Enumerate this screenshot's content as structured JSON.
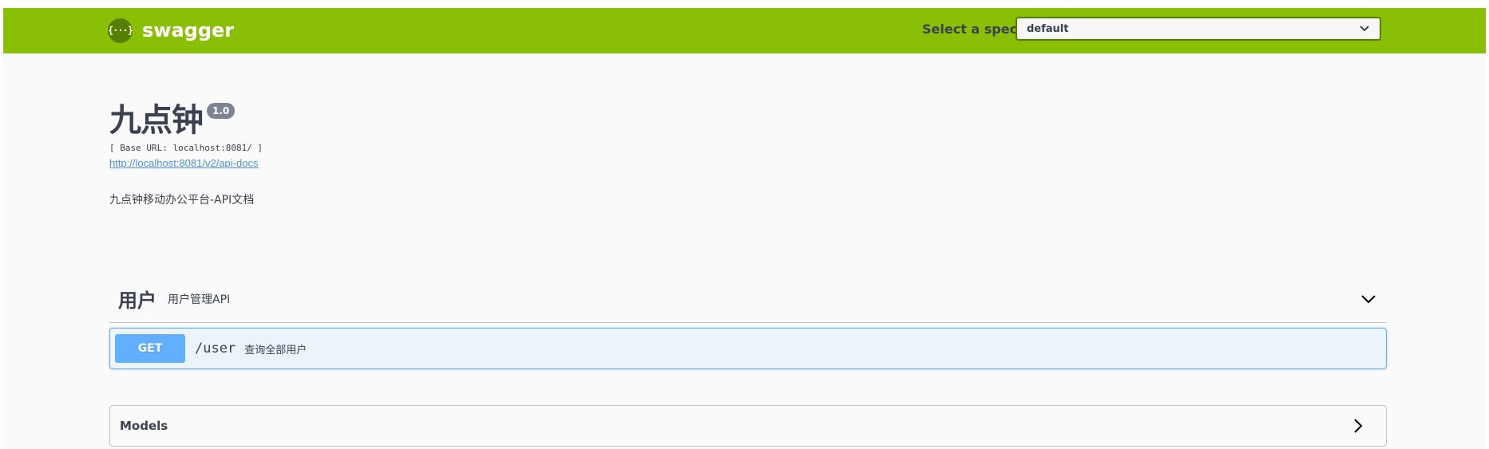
{
  "header": {
    "logo_glyph": "{···}",
    "brand_name": "swagger",
    "spec_label": "Select a spec",
    "spec_selected": "default",
    "bar_color": "#89bf04"
  },
  "info": {
    "title": "九点钟",
    "version": "1.0",
    "base_url": "[ Base URL: localhost:8081/ ]",
    "api_docs_url": "http://localhost:8081/v2/api-docs",
    "description": "九点钟移动办公平台-API文档"
  },
  "tags": [
    {
      "name": "用户",
      "description": "用户管理API",
      "expanded": true,
      "operations": [
        {
          "method": "GET",
          "path": "/user",
          "summary": "查询全部用户",
          "color": "#61affe"
        }
      ]
    }
  ],
  "models": {
    "title": "Models",
    "expanded": false
  }
}
